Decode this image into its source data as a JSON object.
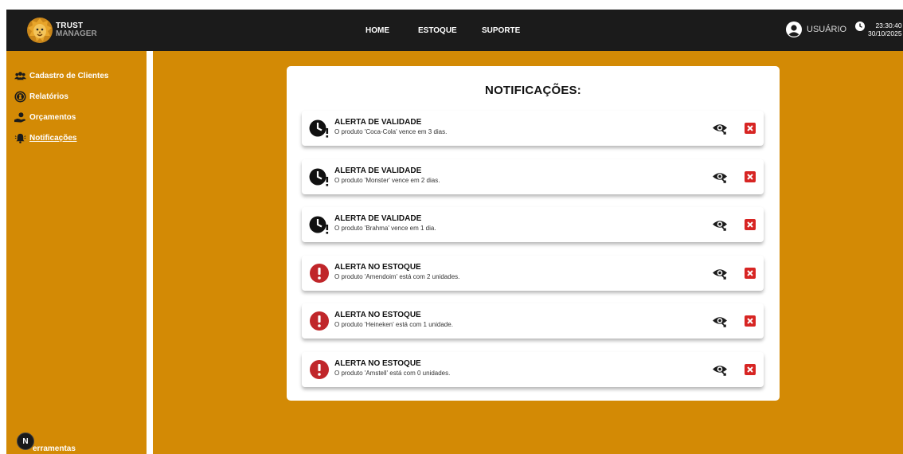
{
  "app": {
    "brand_line1": "TRUST",
    "brand_line2": "MANAGER"
  },
  "nav": {
    "home": "HOME",
    "estoque": "ESTOQUE",
    "suporte": "SUPORTE"
  },
  "user": {
    "label": "USUÁRIO"
  },
  "clock": {
    "time": "23:30:40",
    "date": "30/10/2025"
  },
  "sidebar": {
    "items": [
      {
        "label": "Cadastro de Clientes",
        "icon": "users-icon"
      },
      {
        "label": "Relatórios",
        "icon": "coin-icon"
      },
      {
        "label": "Orçamentos",
        "icon": "hand-coin-icon"
      },
      {
        "label": "Notificações",
        "icon": "bell-icon",
        "active": true
      }
    ],
    "tools_label": "Ferramentas",
    "tools_label_visible": "erramentas",
    "fab_letter": "N"
  },
  "panel": {
    "title": "NOTIFICAÇÕES:",
    "notifications": [
      {
        "type": "validade",
        "icon": "clock-alert-icon",
        "title": "ALERTA DE VALIDADE",
        "message": "O produto 'Coca-Cola' vence em 3 dias."
      },
      {
        "type": "validade",
        "icon": "clock-alert-icon",
        "title": "ALERTA DE VALIDADE",
        "message": "O produto 'Monster' vence em 2 dias."
      },
      {
        "type": "validade",
        "icon": "clock-alert-icon",
        "title": "ALERTA DE VALIDADE",
        "message": "O produto 'Brahma' vence em 1 dia."
      },
      {
        "type": "estoque",
        "icon": "exclamation-circle-icon",
        "title": "ALERTA NO ESTOQUE",
        "message": "O produto 'Amendoim' está com 2 unidades."
      },
      {
        "type": "estoque",
        "icon": "exclamation-circle-icon",
        "title": "ALERTA NO ESTOQUE",
        "message": "O produto 'Heineken' está com 1 unidade."
      },
      {
        "type": "estoque",
        "icon": "exclamation-circle-icon",
        "title": "ALERTA NO ESTOQUE",
        "message": "O produto 'Amstell' está com 0 unidades."
      }
    ]
  },
  "colors": {
    "background": "#d38a05",
    "header": "#1b1b1b",
    "alert_red": "#c0262a",
    "close_red": "#d72523"
  }
}
